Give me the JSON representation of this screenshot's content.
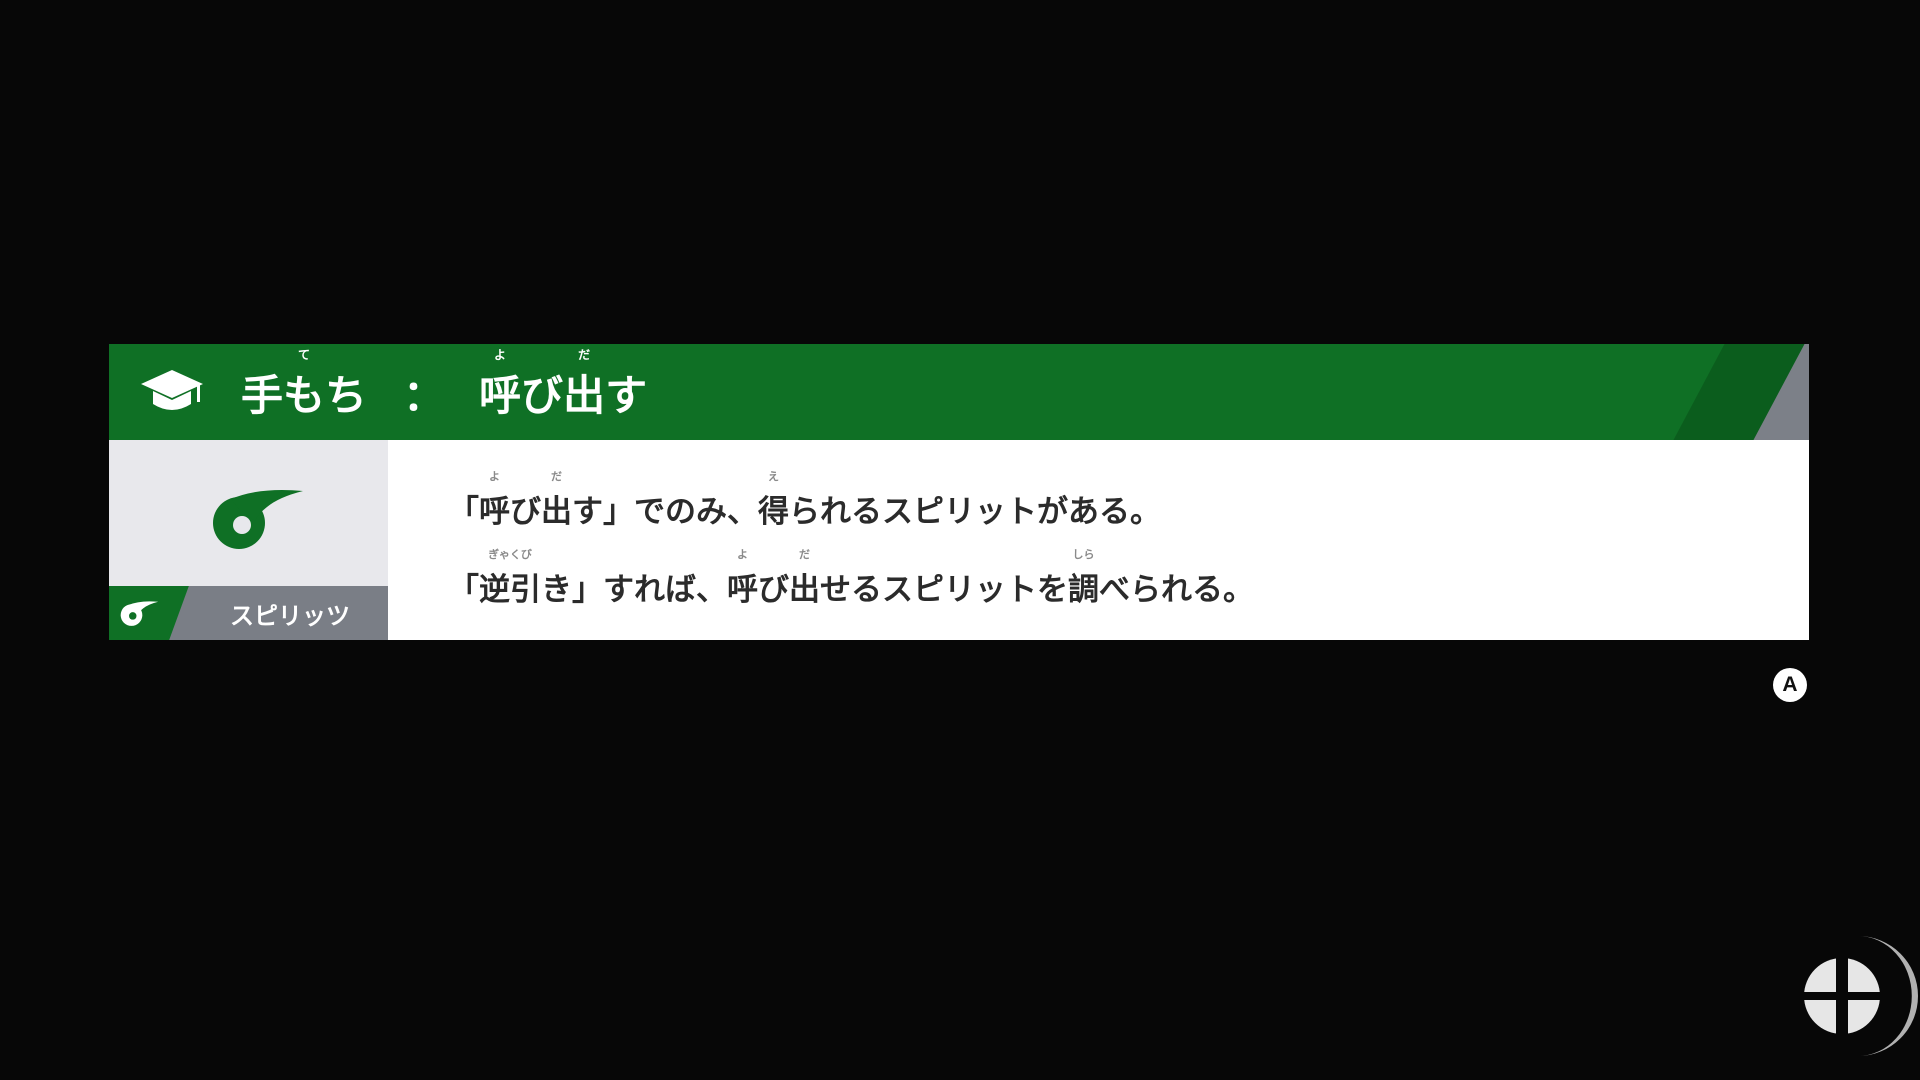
{
  "tip": {
    "category": "手もち",
    "category_ruby": "て",
    "separator": "：",
    "title_kanji": "呼",
    "title_kanji_ruby": "よ",
    "title_mid": "び",
    "title_kanji2": "出",
    "title_kanji2_ruby": "だ",
    "title_end": "す",
    "tag_label": "スピリッツ",
    "line1": {
      "p1": "「",
      "k1": "呼",
      "r1": "よ",
      "p2": "び",
      "k2": "出",
      "r2": "だ",
      "p3": "す」でのみ、",
      "k3": "得",
      "r3": "え",
      "p4": "られるスピリットがある。"
    },
    "line2": {
      "p1": "「",
      "k1": "逆引",
      "r1": "ぎゃくび",
      "p2": "き」すれば、",
      "k2": "呼",
      "r2": "よ",
      "p3": "び",
      "k3": "出",
      "r3": "だ",
      "p4": "せるスピリットを",
      "k4": "調",
      "r4": "しら",
      "p5": "べられる。"
    }
  },
  "buttons": {
    "a_label": "A"
  },
  "icons": {
    "header": "graduation-cap-icon",
    "category": "spirit-icon",
    "loading": "smash-emblem-icon"
  },
  "colors": {
    "header_green": "#0f7025",
    "stripe_dark": "#0b5d1d",
    "tag_grey": "#7a7e86",
    "body_white": "#ffffff",
    "panel_grey": "#e8e8ec"
  }
}
